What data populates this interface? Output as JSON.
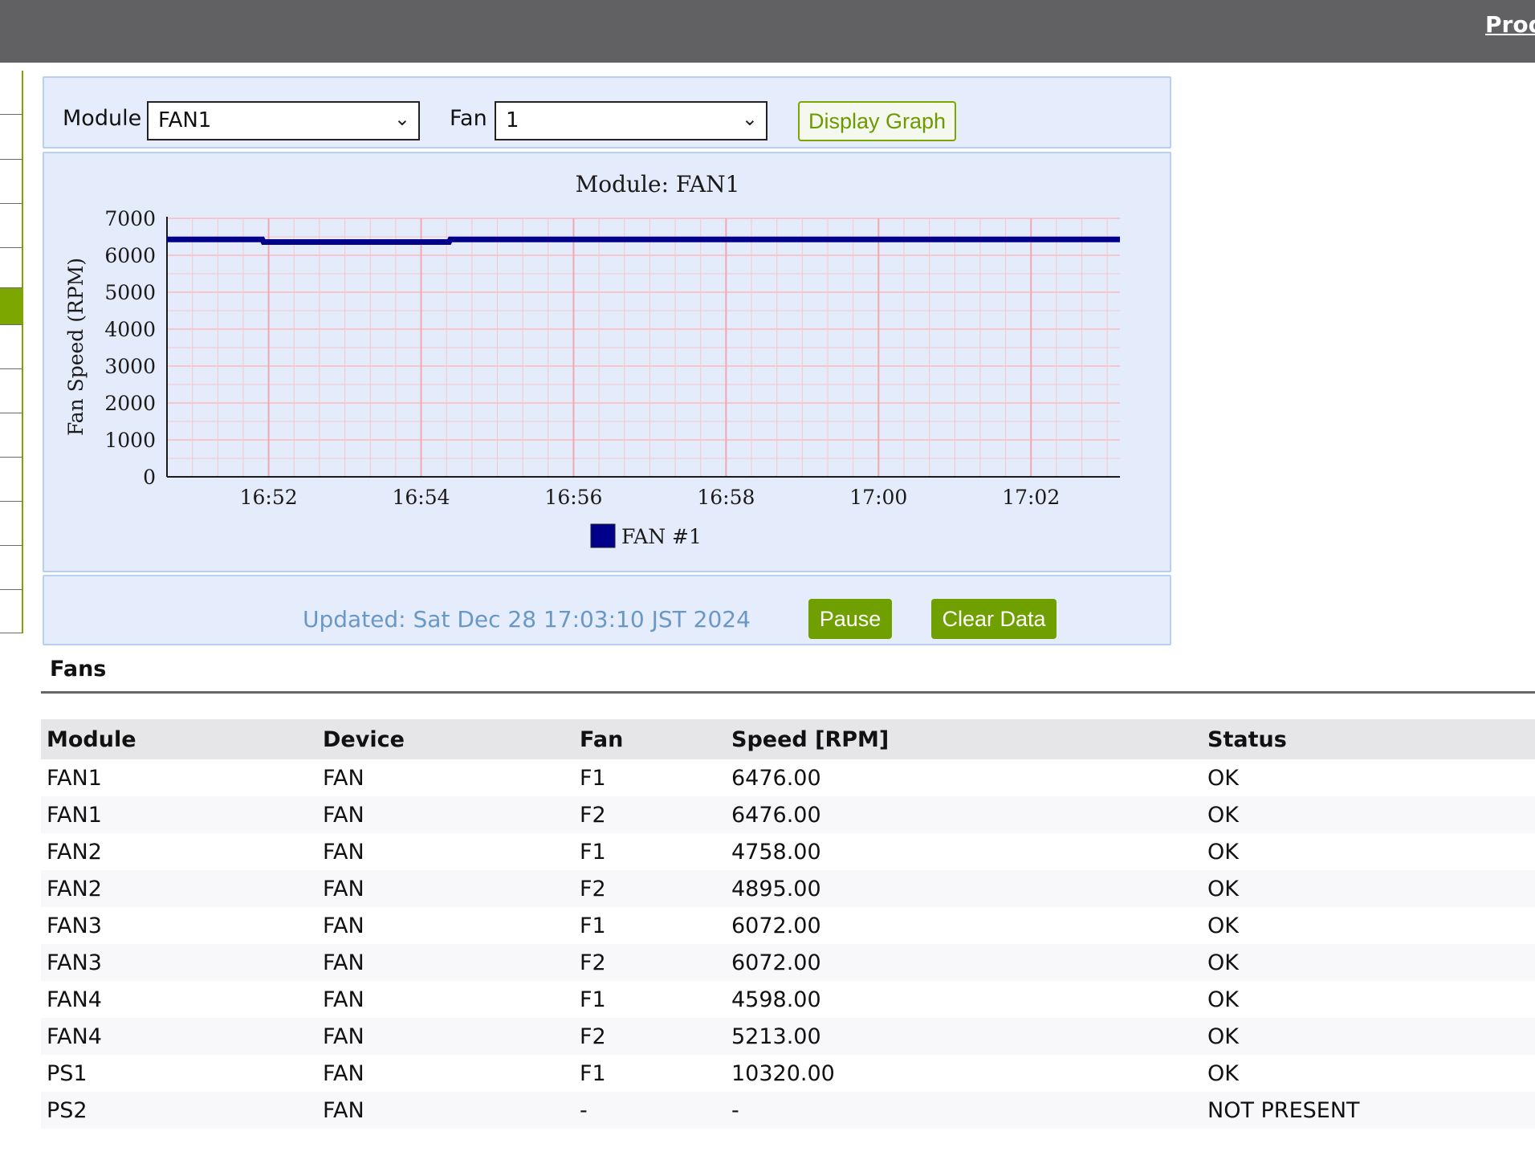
{
  "topbar": {
    "link_label": "Product"
  },
  "controls": {
    "module_label": "Module",
    "module_value": "FAN1",
    "fan_label": "Fan",
    "fan_value": "1",
    "display_graph_label": "Display Graph"
  },
  "status": {
    "updated": "Updated: Sat Dec 28 17:03:10 JST 2024",
    "pause_label": "Pause",
    "clear_label": "Clear Data"
  },
  "colors": {
    "accent": "#7ca600",
    "series": "#00008b",
    "grid": "#f6c6cc"
  },
  "chart_data": {
    "type": "line",
    "title": "Module: FAN1",
    "ylabel": "Fan Speed (RPM)",
    "xlabel": "",
    "ylim": [
      0,
      7000
    ],
    "y_ticks": [
      "0",
      "1000",
      "2000",
      "3000",
      "4000",
      "5000",
      "6000",
      "7000"
    ],
    "x_ticks": [
      "16:52",
      "16:54",
      "16:56",
      "16:58",
      "17:00",
      "17:02"
    ],
    "x_range": [
      "16:50:40",
      "17:03:10"
    ],
    "grid": true,
    "legend_position": "bottom",
    "series": [
      {
        "name": "FAN #1",
        "x": [
          "16:50:40",
          "16:51:55",
          "16:51:56",
          "16:54:22",
          "16:54:23",
          "17:03:10"
        ],
        "values": [
          6430,
          6430,
          6360,
          6360,
          6430,
          6430
        ]
      }
    ]
  },
  "fans_section": {
    "title": "Fans",
    "headers": [
      "Module",
      "Device",
      "Fan",
      "Speed [RPM]",
      "Status"
    ],
    "rows": [
      [
        "FAN1",
        "FAN",
        "F1",
        "6476.00",
        "OK"
      ],
      [
        "FAN1",
        "FAN",
        "F2",
        "6476.00",
        "OK"
      ],
      [
        "FAN2",
        "FAN",
        "F1",
        "4758.00",
        "OK"
      ],
      [
        "FAN2",
        "FAN",
        "F2",
        "4895.00",
        "OK"
      ],
      [
        "FAN3",
        "FAN",
        "F1",
        "6072.00",
        "OK"
      ],
      [
        "FAN3",
        "FAN",
        "F2",
        "6072.00",
        "OK"
      ],
      [
        "FAN4",
        "FAN",
        "F1",
        "4598.00",
        "OK"
      ],
      [
        "FAN4",
        "FAN",
        "F2",
        "5213.00",
        "OK"
      ],
      [
        "PS1",
        "FAN",
        "F1",
        "10320.00",
        "OK"
      ],
      [
        "PS2",
        "FAN",
        "-",
        "-",
        "NOT PRESENT"
      ]
    ]
  }
}
